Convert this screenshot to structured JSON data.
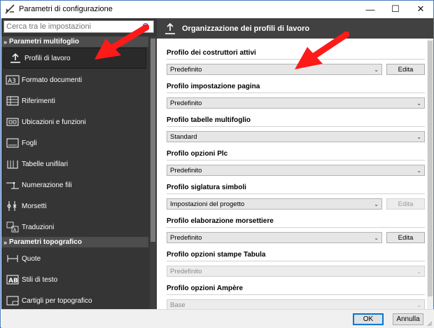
{
  "window": {
    "title": "Parametri di configurazione",
    "controls": {
      "minimize": "—",
      "maximize": "☐",
      "close": "✕"
    }
  },
  "sidebar": {
    "search_placeholder": "Cerca tra le impostazioni",
    "sections": [
      {
        "title": "Parametri multifoglio",
        "items": [
          {
            "label": "Profili di lavoro",
            "icon": "upload-icon",
            "active": true
          },
          {
            "label": "Formato documenti",
            "icon": "a3-paper-icon"
          },
          {
            "label": "Riferimenti",
            "icon": "references-icon"
          },
          {
            "label": "Ubicazioni e funzioni",
            "icon": "locations-icon"
          },
          {
            "label": "Fogli",
            "icon": "sheets-icon"
          },
          {
            "label": "Tabelle unifilari",
            "icon": "single-line-tables-icon"
          },
          {
            "label": "Numerazione fili",
            "icon": "wire-numbering-icon"
          },
          {
            "label": "Morsetti",
            "icon": "terminals-icon"
          },
          {
            "label": "Traduzioni",
            "icon": "translation-icon"
          }
        ]
      },
      {
        "title": "Parametri topografico",
        "items": [
          {
            "label": "Quote",
            "icon": "dimensions-icon"
          },
          {
            "label": "Stili di testo",
            "icon": "text-style-icon"
          },
          {
            "label": "Cartigli per topografico",
            "icon": "title-block-icon"
          }
        ]
      }
    ]
  },
  "main": {
    "header_title": "Organizzazione dei profili di lavoro",
    "groups": [
      {
        "title": "Profilo dei costruttori attivi",
        "value": "Predefinito",
        "button": "Edita",
        "button_enabled": true,
        "combo_enabled": true
      },
      {
        "title": "Profilo impostazione pagina",
        "value": "Predefinito",
        "combo_enabled": true
      },
      {
        "title": "Profilo tabelle multifoglio",
        "value": "Standard",
        "combo_enabled": true
      },
      {
        "title": "Profilo opzioni Plc",
        "value": "Predefinito",
        "combo_enabled": true
      },
      {
        "title": "Profilo siglatura simboli",
        "value": "Impostazioni del progetto",
        "button": "Edita",
        "button_enabled": false,
        "combo_enabled": true
      },
      {
        "title": "Profilo elaborazione morsettiere",
        "value": "Predefinito",
        "button": "Edita",
        "button_enabled": true,
        "combo_enabled": true
      },
      {
        "title": "Profilo opzioni stampe Tabula",
        "value": "Predefinito",
        "combo_enabled": false
      },
      {
        "title": "Profilo opzioni Ampère",
        "value": "Base",
        "combo_enabled": false
      }
    ]
  },
  "footer": {
    "ok": "OK",
    "cancel": "Annulla"
  },
  "colors": {
    "annotation_arrow": "#ff1a1a",
    "sidebar_bg": "#353535",
    "header_bg": "#414141",
    "accent": "#0078d7"
  }
}
